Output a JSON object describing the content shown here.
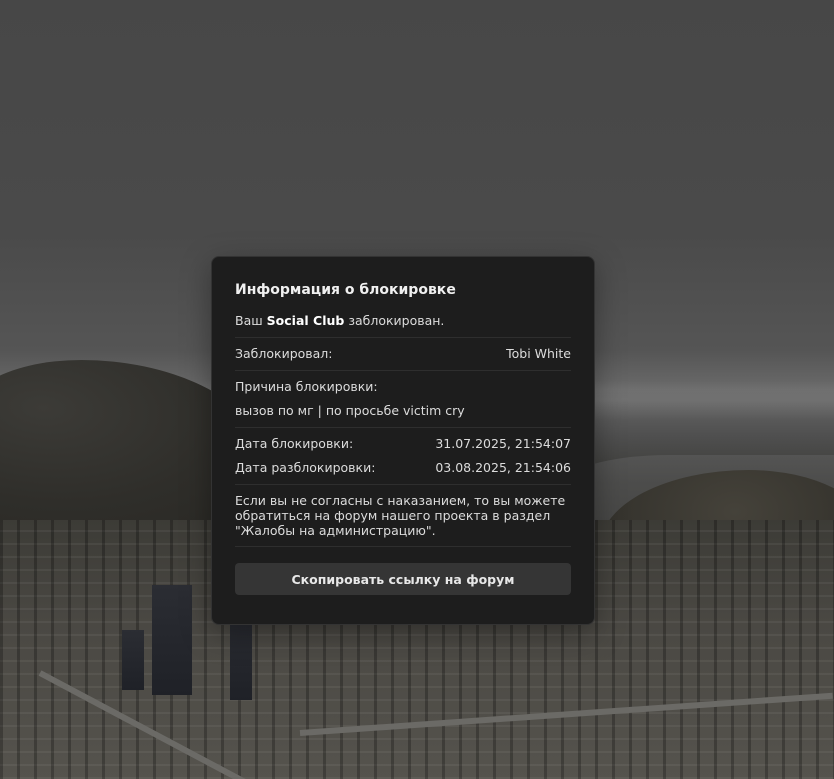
{
  "dialog": {
    "title": "Информация о блокировке",
    "account_prefix": "Ваш",
    "account_name": "Social Club",
    "account_suffix": "заблокирован.",
    "blocked_by_label": "Заблокировал:",
    "blocked_by_value": "Tobi White",
    "reason_label": "Причина блокировки:",
    "reason_value": "вызов по мг | по просьбе victim cry",
    "block_date_label": "Дата блокировки:",
    "block_date_value": "31.07.2025, 21:54:07",
    "unblock_date_label": "Дата разблокировки:",
    "unblock_date_value": "03.08.2025, 21:54:06",
    "appeal_note": "Если вы не согласны с наказанием, то вы можете обратиться на форум нашего проекта в раздел \"Жалобы на администрацию\".",
    "copy_button_label": "Скопировать ссылку на форум"
  },
  "colors": {
    "dialog_bg": "#1d1d1d",
    "button_bg": "#353535",
    "text": "#dcdcdc"
  }
}
